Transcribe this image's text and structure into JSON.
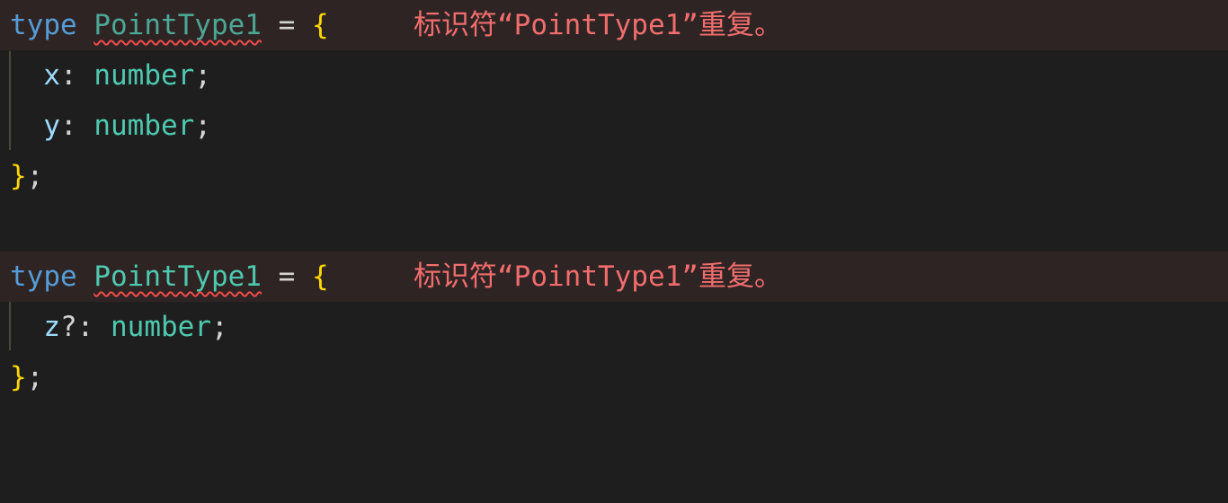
{
  "editor": {
    "block1": {
      "keyword": "type",
      "name": "PointType1",
      "equals": "=",
      "open_brace": "{",
      "diagnostic": "标识符“PointType1”重复。",
      "props": [
        {
          "name": "x",
          "sep": ":",
          "type": "number",
          "end": ";"
        },
        {
          "name": "y",
          "sep": ":",
          "type": "number",
          "end": ";"
        }
      ],
      "close_brace": "}",
      "close_end": ";"
    },
    "block2": {
      "keyword": "type",
      "name": "PointType1",
      "equals": "=",
      "open_brace": "{",
      "diagnostic": "标识符“PointType1”重复。",
      "props": [
        {
          "name": "z",
          "sep": "?:",
          "type": "number",
          "end": ";"
        }
      ],
      "close_brace": "}",
      "close_end": ";"
    }
  },
  "colors": {
    "background": "#1e1e1e",
    "error_line_background": "#2f2424",
    "keyword": "#569cd6",
    "type": "#4ec9b0",
    "property": "#9cdcfe",
    "brace": "#ffd700",
    "diagnostic": "#f16d6d",
    "squiggle": "#f14c4c"
  }
}
